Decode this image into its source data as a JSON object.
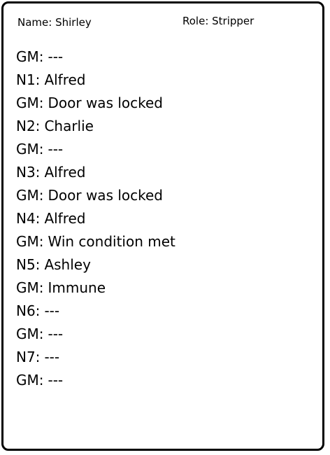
{
  "header": {
    "name_text": "Name: Shirley",
    "role_text": "Role: Stripper"
  },
  "log": [
    {
      "key": "GM:",
      "value": "---"
    },
    {
      "key": "N1:",
      "value": "Alfred"
    },
    {
      "key": "GM:",
      "value": "Door was locked"
    },
    {
      "key": "N2:",
      "value": "Charlie"
    },
    {
      "key": "GM:",
      "value": "---"
    },
    {
      "key": "N3:",
      "value": "Alfred"
    },
    {
      "key": "GM:",
      "value": "Door was locked"
    },
    {
      "key": "N4:",
      "value": "Alfred"
    },
    {
      "key": "GM:",
      "value": "Win condition met"
    },
    {
      "key": "N5:",
      "value": "Ashley"
    },
    {
      "key": "GM:",
      "value": "Immune"
    },
    {
      "key": "N6:",
      "value": "---"
    },
    {
      "key": "GM:",
      "value": "---"
    },
    {
      "key": "N7:",
      "value": "---"
    },
    {
      "key": "GM:",
      "value": "---"
    }
  ]
}
